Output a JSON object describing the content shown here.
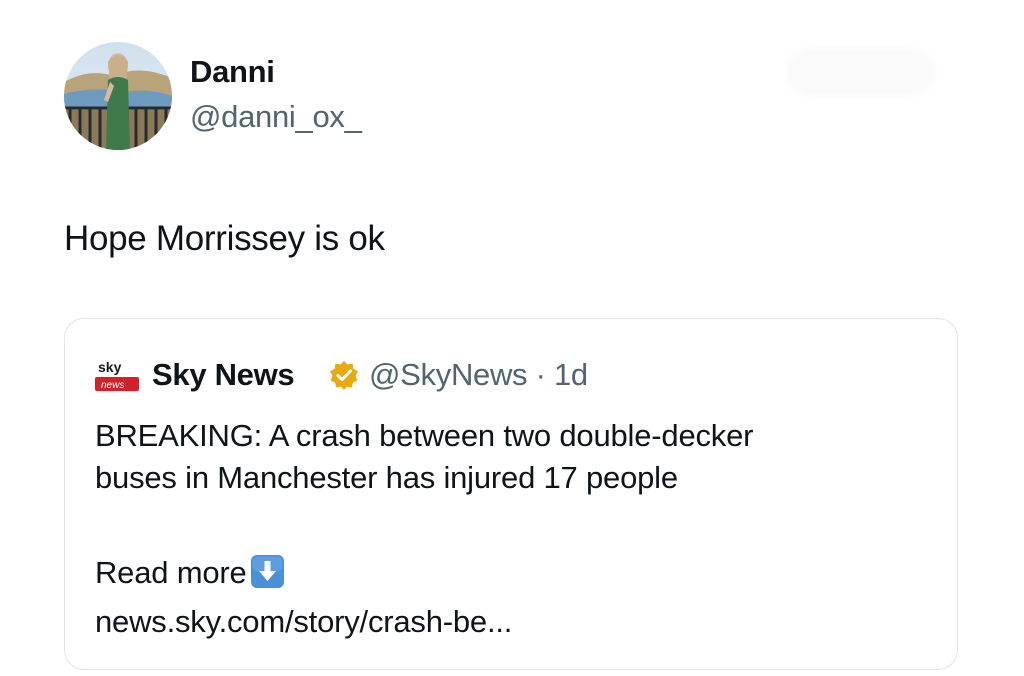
{
  "author": {
    "display_name": "Danni",
    "handle": "@danni_ox_"
  },
  "tweet": {
    "text": "Hope Morrissey is ok"
  },
  "quoted_tweet": {
    "logo_text_top": "sky",
    "logo_text_bottom": "news",
    "author_name": "Sky News",
    "verified_badge_color": "#e8a912",
    "handle": "@SkyNews",
    "separator": "·",
    "time": "1d",
    "body_lines": [
      "BREAKING: A crash between two double-decker",
      "buses in Manchester has injured 17 people"
    ],
    "read_more": "Read more",
    "read_more_icon": "down-arrow-icon",
    "link": "news.sky.com/story/crash-be..."
  },
  "colors": {
    "text_primary": "#0f1419",
    "text_secondary": "#536471",
    "card_border": "#e1e6ea",
    "down_arrow_button": "#4a90d9",
    "sky_logo_red": "#d4202b"
  }
}
